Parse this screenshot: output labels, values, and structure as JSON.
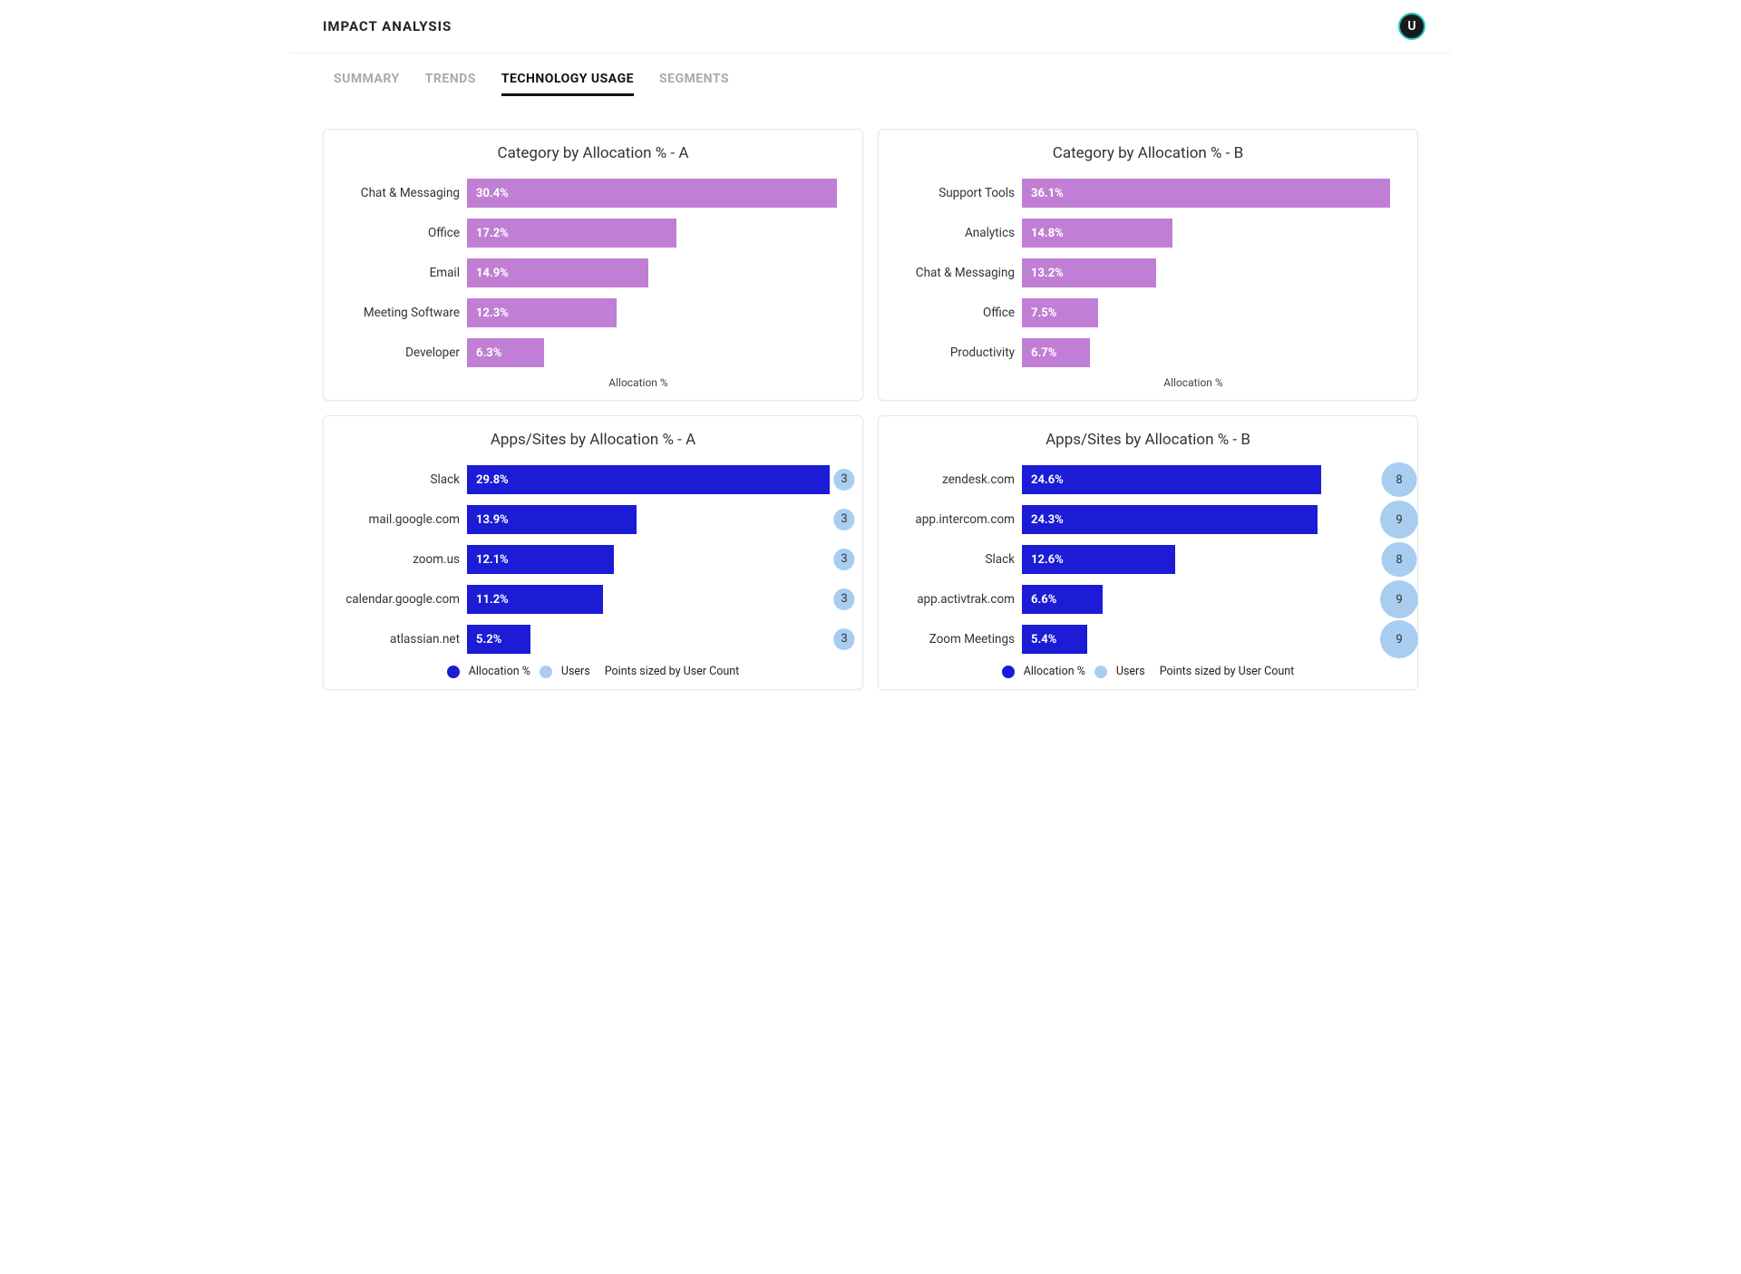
{
  "header": {
    "title": "IMPACT ANALYSIS",
    "avatar_initial": "U"
  },
  "tabs": [
    "SUMMARY",
    "TRENDS",
    "TECHNOLOGY USAGE",
    "SEGMENTS"
  ],
  "active_tab": "TECHNOLOGY USAGE",
  "cards": {
    "catA": {
      "title": "Category by Allocation % - A",
      "xlabel": "Allocation %"
    },
    "catB": {
      "title": "Category by Allocation % - B",
      "xlabel": "Allocation %"
    },
    "appA": {
      "title": "Apps/Sites by Allocation % - A",
      "legend": {
        "alloc": "Allocation %",
        "users": "Users",
        "note": "Points sized by User Count"
      }
    },
    "appB": {
      "title": "Apps/Sites by Allocation % - B",
      "legend": {
        "alloc": "Allocation %",
        "users": "Users",
        "note": "Points sized by User Count"
      }
    }
  },
  "colors": {
    "category_bar": "#c07fd4",
    "app_bar": "#1c1bd6",
    "user_bubble": "#a9cdf1"
  },
  "chart_data": [
    {
      "id": "catA",
      "type": "bar",
      "orientation": "horizontal",
      "title": "Category by Allocation % - A",
      "xlabel": "Allocation %",
      "categories": [
        "Chat & Messaging",
        "Office",
        "Email",
        "Meeting Software",
        "Developer"
      ],
      "values": [
        30.4,
        17.2,
        14.9,
        12.3,
        6.3
      ],
      "value_labels": [
        "30.4%",
        "17.2%",
        "14.9%",
        "12.3%",
        "6.3%"
      ],
      "xmax": 31
    },
    {
      "id": "catB",
      "type": "bar",
      "orientation": "horizontal",
      "title": "Category by Allocation % - B",
      "xlabel": "Allocation %",
      "categories": [
        "Support Tools",
        "Analytics",
        "Chat & Messaging",
        "Office",
        "Productivity"
      ],
      "values": [
        36.1,
        14.8,
        13.2,
        7.5,
        6.7
      ],
      "value_labels": [
        "36.1%",
        "14.8%",
        "13.2%",
        "7.5%",
        "6.7%"
      ],
      "xmax": 37
    },
    {
      "id": "appA",
      "type": "bar",
      "orientation": "horizontal",
      "title": "Apps/Sites by Allocation % - A",
      "categories": [
        "Slack",
        "mail.google.com",
        "zoom.us",
        "calendar.google.com",
        "atlassian.net"
      ],
      "series": [
        {
          "name": "Allocation %",
          "values": [
            29.8,
            13.9,
            12.1,
            11.2,
            5.2
          ],
          "value_labels": [
            "29.8%",
            "13.9%",
            "12.1%",
            "11.2%",
            "5.2%"
          ]
        },
        {
          "name": "Users",
          "values": [
            3,
            3,
            3,
            3,
            3
          ]
        }
      ],
      "xmax": 31,
      "user_max": 9,
      "legend_note": "Points sized by User Count"
    },
    {
      "id": "appB",
      "type": "bar",
      "orientation": "horizontal",
      "title": "Apps/Sites by Allocation % - B",
      "categories": [
        "zendesk.com",
        "app.intercom.com",
        "Slack",
        "app.activtrak.com",
        "Zoom Meetings"
      ],
      "series": [
        {
          "name": "Allocation %",
          "values": [
            24.6,
            24.3,
            12.6,
            6.6,
            5.4
          ],
          "value_labels": [
            "24.6%",
            "24.3%",
            "12.6%",
            "6.6%",
            "5.4%"
          ]
        },
        {
          "name": "Users",
          "values": [
            8,
            9,
            8,
            9,
            9
          ]
        }
      ],
      "xmax": 31,
      "user_max": 9,
      "legend_note": "Points sized by User Count"
    }
  ]
}
